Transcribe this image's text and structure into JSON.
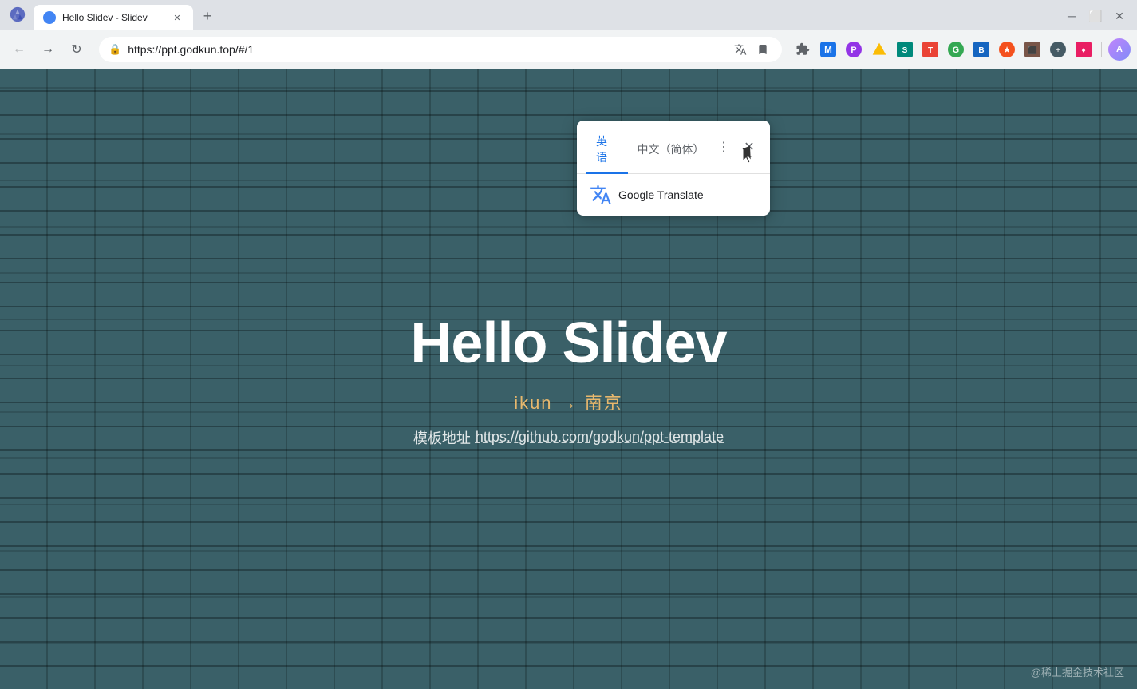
{
  "browser": {
    "tab": {
      "title": "Hello Slidev - Slidev",
      "favicon_color": "#4285f4"
    },
    "new_tab_label": "+",
    "address": "https://ppt.godkun.top/#/1",
    "title_bar_minimize": "─",
    "title_bar_max": "□",
    "title_bar_close": "✕"
  },
  "translate_popup": {
    "tab_english": "英语",
    "tab_chinese": "中文（简体）",
    "more_icon": "⋮",
    "close_icon": "✕",
    "brand_name": "Google Translate"
  },
  "webpage": {
    "title": "Hello Slidev",
    "subtitle": "ikun → 南京",
    "link_label": "模板地址",
    "link_url": "https://github.com/godkun/ppt-template",
    "watermark": "@稀土掘金技术社区"
  },
  "colors": {
    "accent_blue": "#1a73e8",
    "page_bg": "#3a6068",
    "title_color": "#ffffff",
    "subtitle_color": "#e8b86d"
  }
}
